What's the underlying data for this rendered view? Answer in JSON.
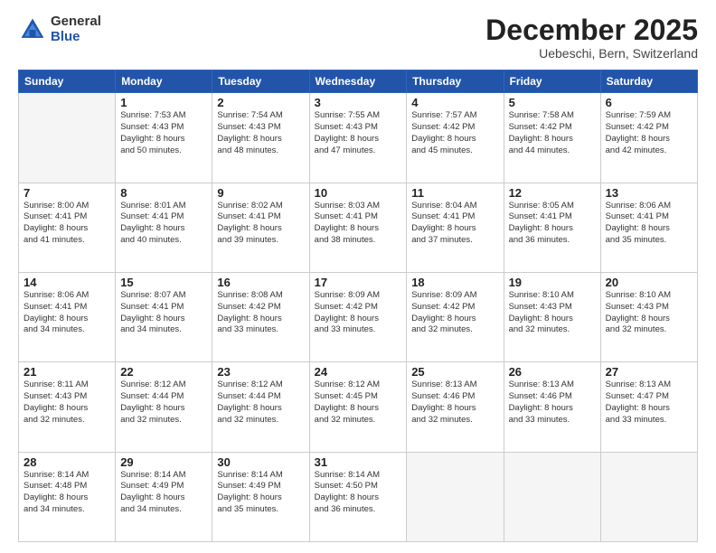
{
  "logo": {
    "general": "General",
    "blue": "Blue"
  },
  "header": {
    "month": "December 2025",
    "location": "Uebeschi, Bern, Switzerland"
  },
  "days_header": [
    "Sunday",
    "Monday",
    "Tuesday",
    "Wednesday",
    "Thursday",
    "Friday",
    "Saturday"
  ],
  "weeks": [
    [
      {
        "day": "",
        "info": ""
      },
      {
        "day": "1",
        "info": "Sunrise: 7:53 AM\nSunset: 4:43 PM\nDaylight: 8 hours\nand 50 minutes."
      },
      {
        "day": "2",
        "info": "Sunrise: 7:54 AM\nSunset: 4:43 PM\nDaylight: 8 hours\nand 48 minutes."
      },
      {
        "day": "3",
        "info": "Sunrise: 7:55 AM\nSunset: 4:43 PM\nDaylight: 8 hours\nand 47 minutes."
      },
      {
        "day": "4",
        "info": "Sunrise: 7:57 AM\nSunset: 4:42 PM\nDaylight: 8 hours\nand 45 minutes."
      },
      {
        "day": "5",
        "info": "Sunrise: 7:58 AM\nSunset: 4:42 PM\nDaylight: 8 hours\nand 44 minutes."
      },
      {
        "day": "6",
        "info": "Sunrise: 7:59 AM\nSunset: 4:42 PM\nDaylight: 8 hours\nand 42 minutes."
      }
    ],
    [
      {
        "day": "7",
        "info": "Sunrise: 8:00 AM\nSunset: 4:41 PM\nDaylight: 8 hours\nand 41 minutes."
      },
      {
        "day": "8",
        "info": "Sunrise: 8:01 AM\nSunset: 4:41 PM\nDaylight: 8 hours\nand 40 minutes."
      },
      {
        "day": "9",
        "info": "Sunrise: 8:02 AM\nSunset: 4:41 PM\nDaylight: 8 hours\nand 39 minutes."
      },
      {
        "day": "10",
        "info": "Sunrise: 8:03 AM\nSunset: 4:41 PM\nDaylight: 8 hours\nand 38 minutes."
      },
      {
        "day": "11",
        "info": "Sunrise: 8:04 AM\nSunset: 4:41 PM\nDaylight: 8 hours\nand 37 minutes."
      },
      {
        "day": "12",
        "info": "Sunrise: 8:05 AM\nSunset: 4:41 PM\nDaylight: 8 hours\nand 36 minutes."
      },
      {
        "day": "13",
        "info": "Sunrise: 8:06 AM\nSunset: 4:41 PM\nDaylight: 8 hours\nand 35 minutes."
      }
    ],
    [
      {
        "day": "14",
        "info": "Sunrise: 8:06 AM\nSunset: 4:41 PM\nDaylight: 8 hours\nand 34 minutes."
      },
      {
        "day": "15",
        "info": "Sunrise: 8:07 AM\nSunset: 4:41 PM\nDaylight: 8 hours\nand 34 minutes."
      },
      {
        "day": "16",
        "info": "Sunrise: 8:08 AM\nSunset: 4:42 PM\nDaylight: 8 hours\nand 33 minutes."
      },
      {
        "day": "17",
        "info": "Sunrise: 8:09 AM\nSunset: 4:42 PM\nDaylight: 8 hours\nand 33 minutes."
      },
      {
        "day": "18",
        "info": "Sunrise: 8:09 AM\nSunset: 4:42 PM\nDaylight: 8 hours\nand 32 minutes."
      },
      {
        "day": "19",
        "info": "Sunrise: 8:10 AM\nSunset: 4:43 PM\nDaylight: 8 hours\nand 32 minutes."
      },
      {
        "day": "20",
        "info": "Sunrise: 8:10 AM\nSunset: 4:43 PM\nDaylight: 8 hours\nand 32 minutes."
      }
    ],
    [
      {
        "day": "21",
        "info": "Sunrise: 8:11 AM\nSunset: 4:43 PM\nDaylight: 8 hours\nand 32 minutes."
      },
      {
        "day": "22",
        "info": "Sunrise: 8:12 AM\nSunset: 4:44 PM\nDaylight: 8 hours\nand 32 minutes."
      },
      {
        "day": "23",
        "info": "Sunrise: 8:12 AM\nSunset: 4:44 PM\nDaylight: 8 hours\nand 32 minutes."
      },
      {
        "day": "24",
        "info": "Sunrise: 8:12 AM\nSunset: 4:45 PM\nDaylight: 8 hours\nand 32 minutes."
      },
      {
        "day": "25",
        "info": "Sunrise: 8:13 AM\nSunset: 4:46 PM\nDaylight: 8 hours\nand 32 minutes."
      },
      {
        "day": "26",
        "info": "Sunrise: 8:13 AM\nSunset: 4:46 PM\nDaylight: 8 hours\nand 33 minutes."
      },
      {
        "day": "27",
        "info": "Sunrise: 8:13 AM\nSunset: 4:47 PM\nDaylight: 8 hours\nand 33 minutes."
      }
    ],
    [
      {
        "day": "28",
        "info": "Sunrise: 8:14 AM\nSunset: 4:48 PM\nDaylight: 8 hours\nand 34 minutes."
      },
      {
        "day": "29",
        "info": "Sunrise: 8:14 AM\nSunset: 4:49 PM\nDaylight: 8 hours\nand 34 minutes."
      },
      {
        "day": "30",
        "info": "Sunrise: 8:14 AM\nSunset: 4:49 PM\nDaylight: 8 hours\nand 35 minutes."
      },
      {
        "day": "31",
        "info": "Sunrise: 8:14 AM\nSunset: 4:50 PM\nDaylight: 8 hours\nand 36 minutes."
      },
      {
        "day": "",
        "info": ""
      },
      {
        "day": "",
        "info": ""
      },
      {
        "day": "",
        "info": ""
      }
    ]
  ]
}
